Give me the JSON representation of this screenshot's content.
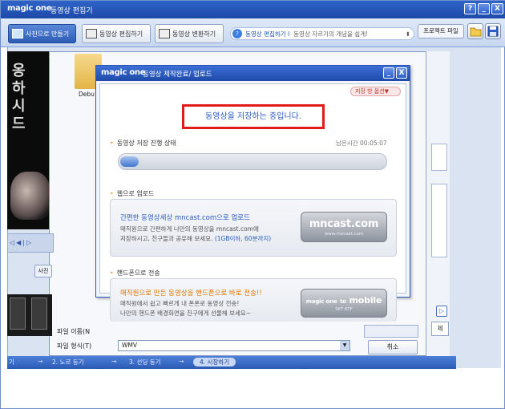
{
  "app": {
    "logo": "magic one",
    "title": "동영상 편집기",
    "window_buttons": [
      "?",
      "_",
      "X"
    ]
  },
  "tabs": [
    {
      "label": "사진으로 만들기",
      "icon": "photo-icon"
    },
    {
      "label": "동영상 편집하기",
      "icon": "film-icon"
    },
    {
      "label": "동영상 변환하기",
      "icon": "convert-icon"
    }
  ],
  "tip": {
    "badge": "?",
    "link": "동영상 편집하기 l",
    "text": "동영상 자르기의 개념을 쉽게!",
    "arrow": "⬍"
  },
  "toolbar": {
    "project_menu": "프로젝트 파일"
  },
  "editor": {
    "folder_label": "Debu",
    "photo_button": "사진",
    "file_name_label": "파일 이름(N",
    "file_format_label": "파일 형식(T)",
    "file_format_value": "WMV",
    "cancel_label": "취소",
    "side_button": "제",
    "play_glyph": "▷",
    "preview_text": [
      "옹",
      "하",
      "시",
      "드"
    ],
    "seek_glyphs": "◁◀|▷"
  },
  "steps": [
    {
      "label": "기"
    },
    {
      "label": "2. 노르 등기"
    },
    {
      "label": "3. 선딩 동기"
    },
    {
      "label": "4. 시장하기"
    }
  ],
  "dialog": {
    "logo": "magic one",
    "title": "동영상 제작완료/ 업로드",
    "save_option": "저장 방 옵션▼",
    "status_message": "동영상을 저장하는 중입니다.",
    "progress_section": "동영상 저장 진행 상태",
    "remaining_label": "남은시간",
    "remaining_time": "00:05:07",
    "progress": 0.07,
    "web_section": "웹으로 업로드",
    "web_head_prefix": "간편한 동영상세상 ",
    "web_head_site": "mncast.com",
    "web_head_suffix": "으로 업로드",
    "web_desc1": "매직원으로 간편하게 나만의 동영상을 mncast.com에",
    "web_desc2_a": "저장하시고, 친구들과 공유해 보세요. ",
    "web_desc2_b": "(1GB이하, 60분까지)",
    "web_logo": "mncast.com",
    "web_logo_sub": "www.mncast.com",
    "phone_section": "핸드폰으로 전송",
    "phone_head": "매직원으로 만든 동영상을 핸드폰으로 바로 전송!!",
    "phone_desc1": "매직원에서 쉽고 빠르게 내 폰폰로 동영상 전송!",
    "phone_desc2": "나만의 핸드폰 배경화면을 친구에게 선물해 보세요~",
    "phone_logo_prefix": "magic one",
    "phone_logo_to": "to",
    "phone_logo_mobile": "mobile",
    "phone_logo_sub": "SKT KTF"
  },
  "colors": {
    "title_blue": "#1e4aa9",
    "status_border": "#e11b1b",
    "status_text": "#2a59c4",
    "progress_fill": "#3f75cf"
  }
}
